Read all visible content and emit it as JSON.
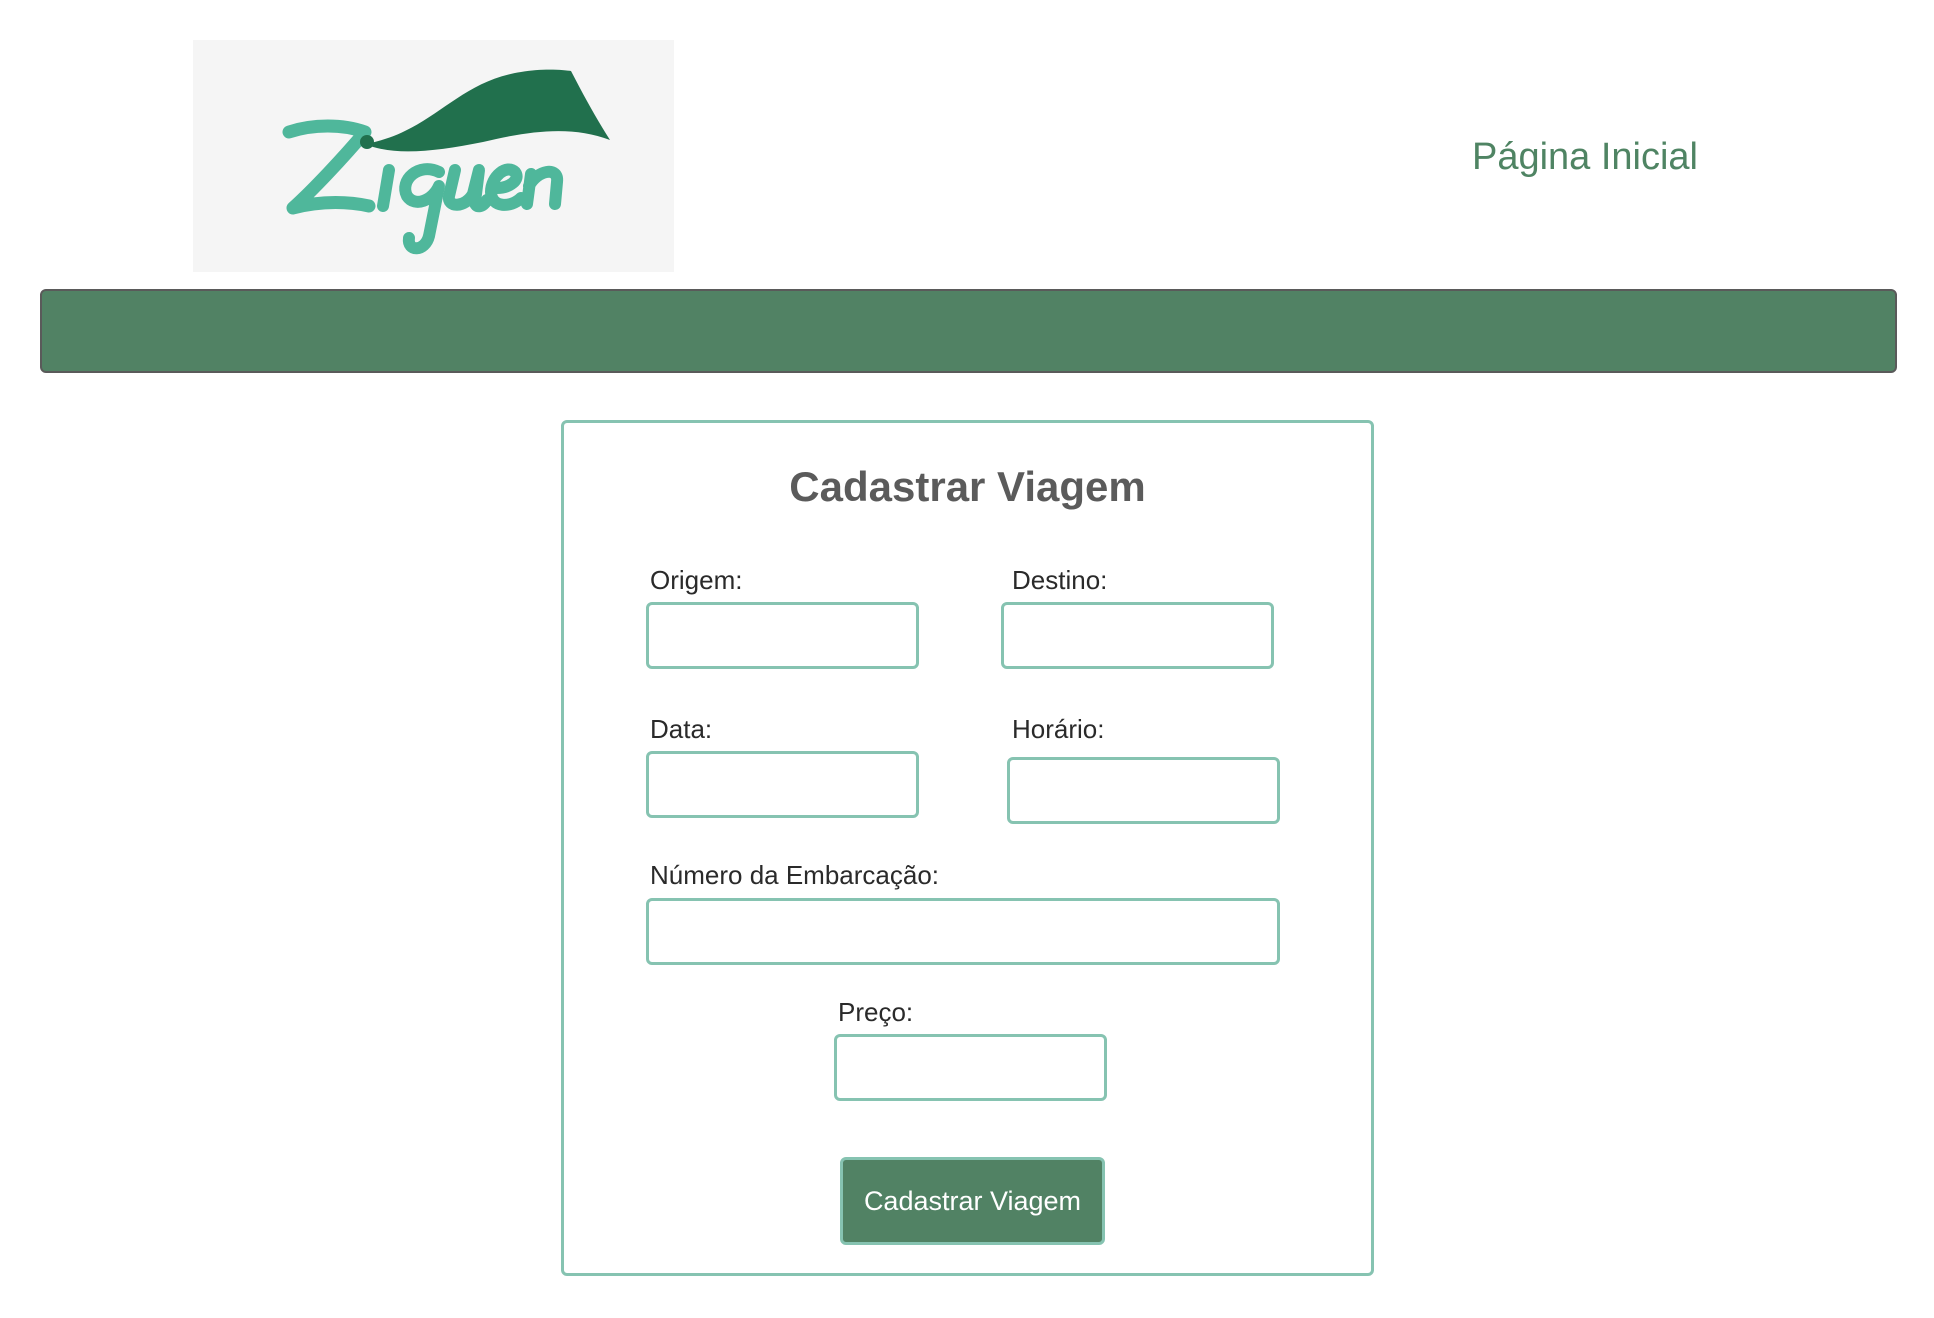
{
  "header": {
    "logo_text": "Ziguen",
    "home_link": "Página Inicial"
  },
  "colors": {
    "brand_green": "#518264",
    "accent_teal": "#86c3b1",
    "logo_teal": "#4fb79b",
    "logo_dark_green": "#21704d",
    "title_gray": "#5b5b5b"
  },
  "form": {
    "title": "Cadastrar Viagem",
    "fields": {
      "origem": {
        "label": "Origem:",
        "value": ""
      },
      "destino": {
        "label": "Destino:",
        "value": ""
      },
      "data": {
        "label": "Data:",
        "value": ""
      },
      "horario": {
        "label": "Horário:",
        "value": ""
      },
      "embarcacao": {
        "label": "Número da Embarcação:",
        "value": ""
      },
      "preco": {
        "label": "Preço:",
        "value": ""
      }
    },
    "submit_label": "Cadastrar Viagem"
  }
}
